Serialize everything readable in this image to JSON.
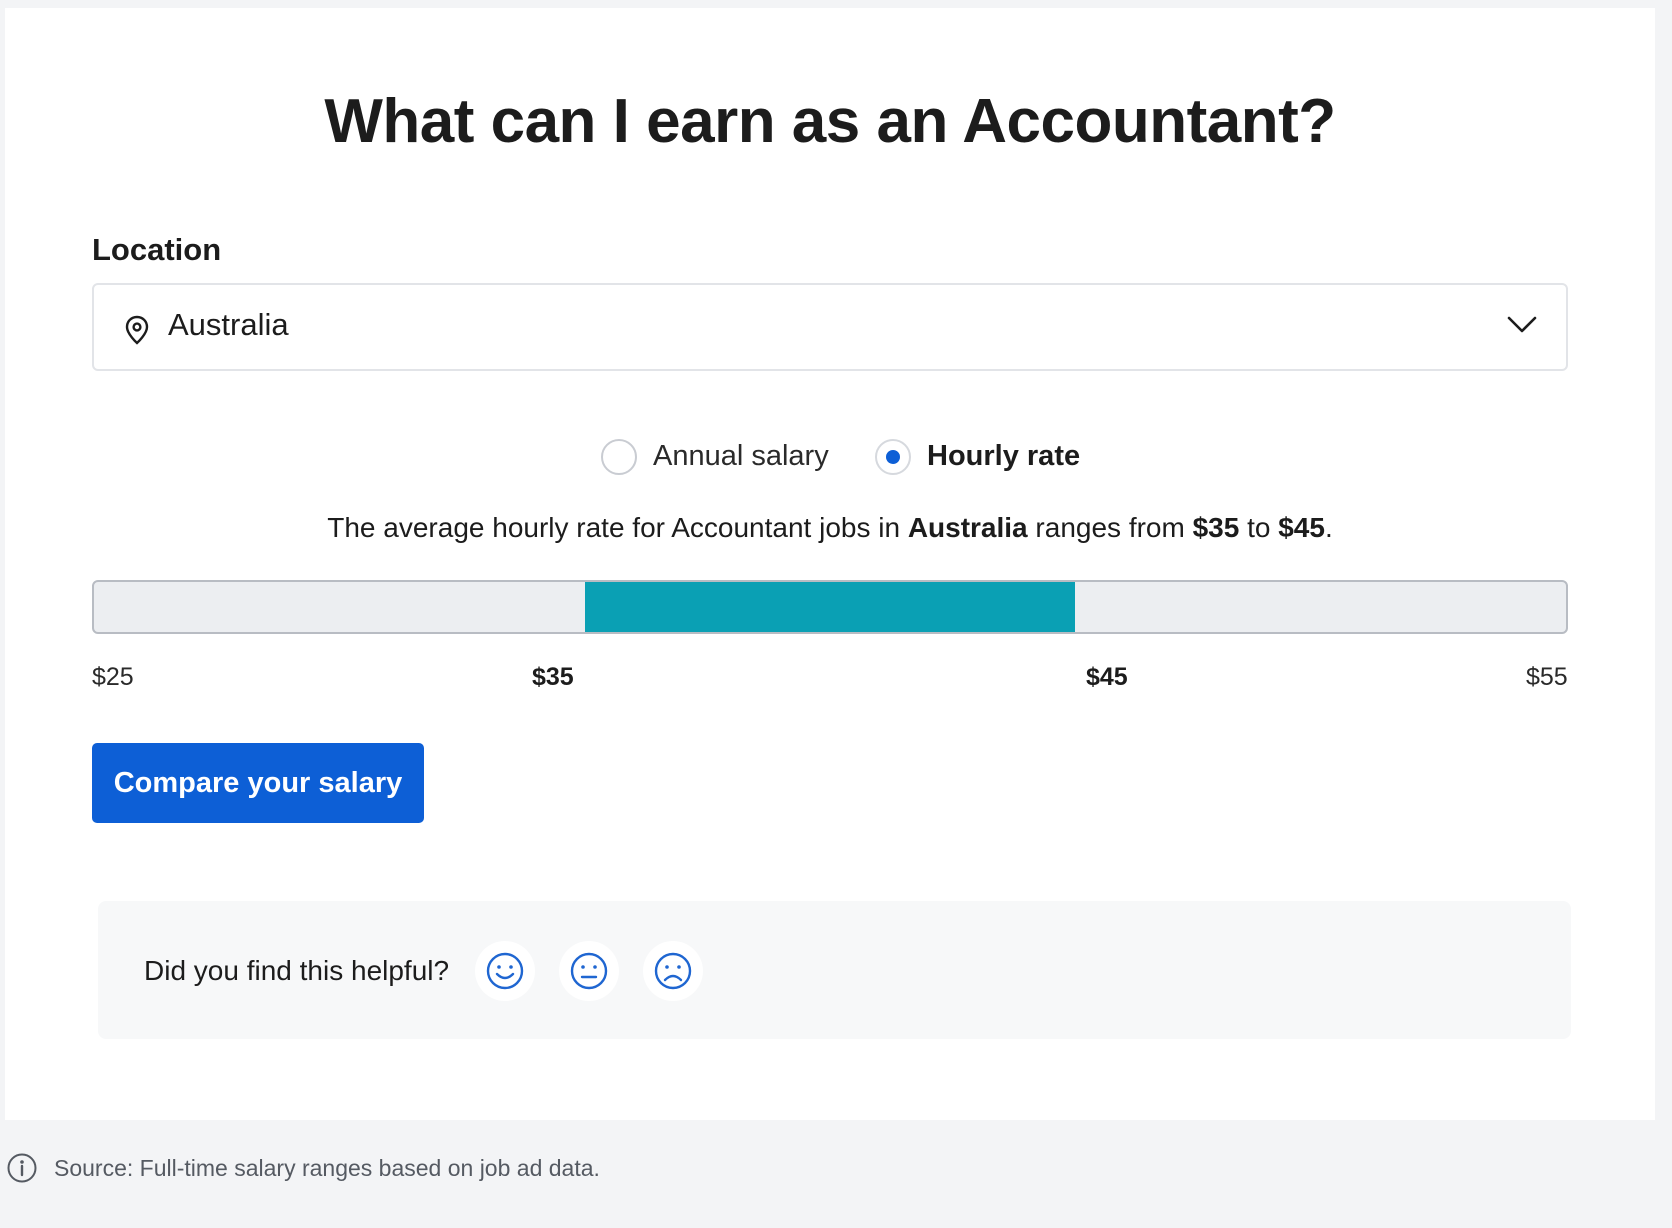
{
  "title": "What can I earn as an Accountant?",
  "location": {
    "label": "Location",
    "value": "Australia",
    "icon": "location-pin-icon"
  },
  "toggle": {
    "options": [
      {
        "label": "Annual salary",
        "selected": false
      },
      {
        "label": "Hourly rate",
        "selected": true
      }
    ]
  },
  "sentence": {
    "prefix": "The average hourly rate for Accountant jobs in ",
    "location": "Australia",
    "middle": " ranges from ",
    "low": "$35",
    "to": " to ",
    "high": "$45",
    "suffix": "."
  },
  "range": {
    "min": 25,
    "max": 55,
    "low": 35,
    "high": 45,
    "fill_color": "#0aa0b4",
    "ticks": [
      "$25",
      "$35",
      "$45",
      "$55"
    ]
  },
  "compare_button": {
    "label": "Compare your salary",
    "color": "#0d5fd6"
  },
  "feedback": {
    "question": "Did you find this helpful?",
    "faces": [
      "happy-face-icon",
      "neutral-face-icon",
      "sad-face-icon"
    ]
  },
  "source": {
    "text": "Source: Full-time salary ranges based on job ad data."
  }
}
